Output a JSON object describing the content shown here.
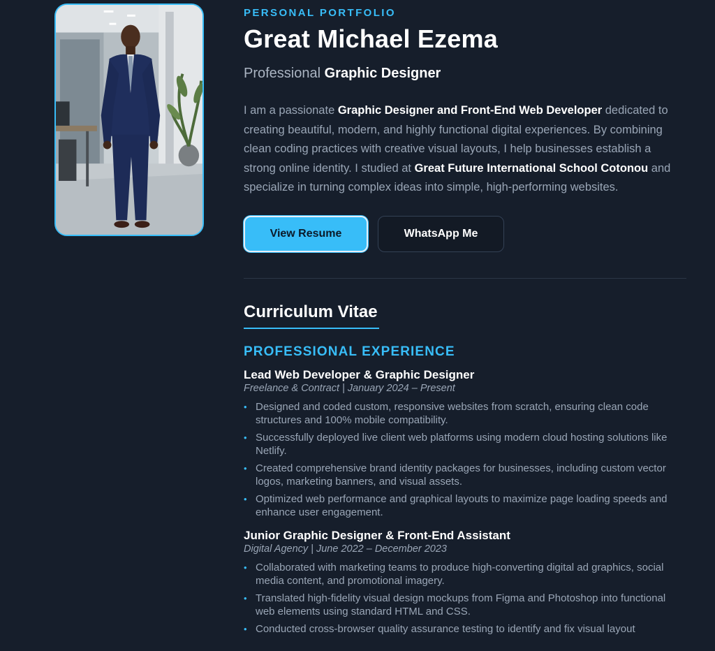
{
  "profile": {
    "eyebrow": "PERSONAL PORTFOLIO",
    "name": "Great Michael Ezema",
    "role_prefix": "Professional",
    "role_strong": "Graphic Designer",
    "bio": {
      "p1": "I am a passionate ",
      "s1": "Graphic Designer and Front-End Web Developer",
      "p2": " dedicated to creating beautiful, modern, and highly functional digital experiences. By combining clean coding practices with creative visual layouts, I help businesses establish a strong online identity. I studied at ",
      "s2": "Great Future International School Cotonou",
      "p3": " and specialize in turning complex ideas into simple, high-performing websites."
    }
  },
  "buttons": {
    "resume": "View Resume",
    "whatsapp": "WhatsApp Me"
  },
  "cv": {
    "title": "Curriculum Vitae",
    "experience_heading": "PROFESSIONAL EXPERIENCE",
    "jobs": [
      {
        "title": "Lead Web Developer & Graphic Designer",
        "meta": "Freelance & Contract | January 2024 – Present",
        "bullets": [
          "Designed and coded custom, responsive websites from scratch, ensuring clean code structures and 100% mobile compatibility.",
          "Successfully deployed live client web platforms using modern cloud hosting solutions like Netlify.",
          "Created comprehensive brand identity packages for businesses, including custom vector logos, marketing banners, and visual assets.",
          "Optimized web performance and graphical layouts to maximize page loading speeds and enhance user engagement."
        ]
      },
      {
        "title": "Junior Graphic Designer & Front-End Assistant",
        "meta": "Digital Agency | June 2022 – December 2023",
        "bullets": [
          "Collaborated with marketing teams to produce high-converting digital ad graphics, social media content, and promotional imagery.",
          "Translated high-fidelity visual design mockups from Figma and Photoshop into functional web elements using standard HTML and CSS.",
          "Conducted cross-browser quality assurance testing to identify and fix visual layout"
        ]
      }
    ]
  },
  "colors": {
    "background": "#161e2b",
    "accent": "#38bdf8",
    "heading": "#ffffff",
    "body_text": "#9aa6b6"
  }
}
